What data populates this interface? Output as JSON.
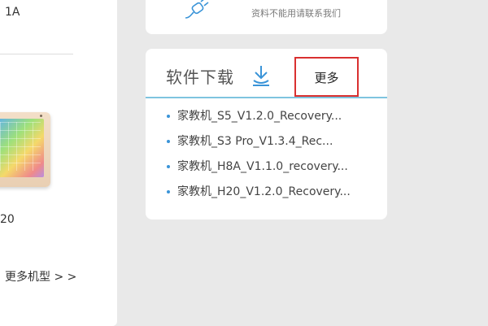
{
  "left_panel": {
    "model_top": "1A",
    "model_bottom": "20",
    "more_models": "更多机型 > >"
  },
  "top_card": {
    "note": "资料不能用请联系我们",
    "icon": "plug-icon"
  },
  "download": {
    "title": "软件下载",
    "icon": "download-icon",
    "more_label": "更多",
    "items": [
      {
        "label": "家教机_S5_V1.2.0_Recovery..."
      },
      {
        "label": "家教机_S3 Pro_V1.3.4_Rec..."
      },
      {
        "label": "家教机_H8A_V1.1.0_recovery..."
      },
      {
        "label": "家教机_H20_V1.2.0_Recovery..."
      }
    ]
  },
  "colors": {
    "accent": "#3a94d8",
    "highlight_border": "#d93030",
    "divider": "#7ec4df"
  }
}
